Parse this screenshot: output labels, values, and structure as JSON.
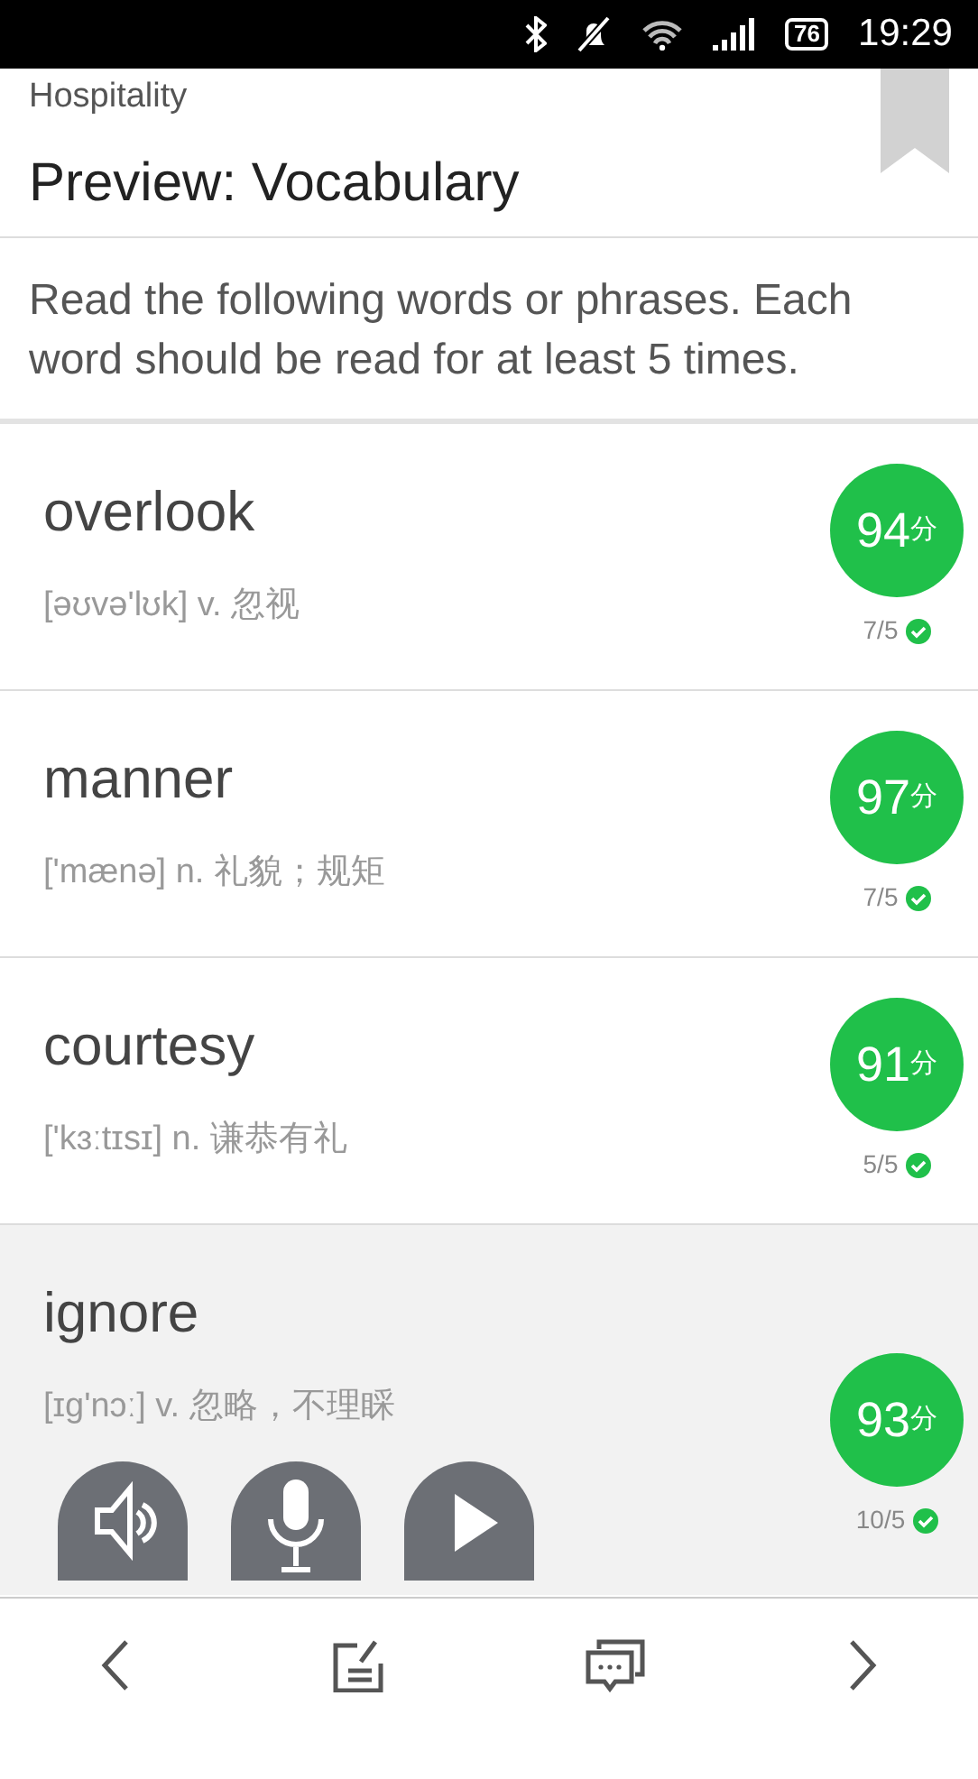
{
  "status_bar": {
    "battery": "76",
    "time": "19:29"
  },
  "header": {
    "category": "Hospitality",
    "title": "Preview: Vocabulary",
    "bookmarked": true
  },
  "instructions": "Read the following words or phrases. Each word should be read for at least 5 times.",
  "words": [
    {
      "word": "overlook",
      "phonetic": "[əʊvə'lʊk] v. 忽视",
      "score": "94",
      "unit": "分",
      "count": "7/5",
      "done": true,
      "selected": false
    },
    {
      "word": "manner",
      "phonetic": "['mænə] n. 礼貌；规矩",
      "score": "97",
      "unit": "分",
      "count": "7/5",
      "done": true,
      "selected": false
    },
    {
      "word": "courtesy",
      "phonetic": "['kɜːtɪsɪ] n. 谦恭有礼",
      "score": "91",
      "unit": "分",
      "count": "5/5",
      "done": true,
      "selected": false
    },
    {
      "word": "ignore",
      "phonetic": "[ɪg'nɔː] v. 忽略，不理睬",
      "score": "93",
      "unit": "分",
      "count": "10/5",
      "done": true,
      "selected": true
    }
  ]
}
